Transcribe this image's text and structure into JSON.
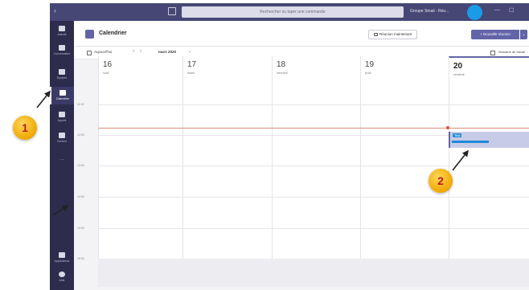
{
  "titlebar": {
    "search_placeholder": "Rechercher ou taper une commande",
    "org_label": "Groupe Smail - Réu..."
  },
  "rail": {
    "items": [
      {
        "icon": "activity-icon",
        "label": "Activité"
      },
      {
        "icon": "chat-icon",
        "label": "Conversation"
      },
      {
        "icon": "teams-icon",
        "label": "Équipes"
      },
      {
        "icon": "calendar-icon",
        "label": "Calendrier",
        "active": true
      },
      {
        "icon": "calls-icon",
        "label": "Appels"
      },
      {
        "icon": "files-icon",
        "label": "Fichiers"
      }
    ],
    "more": "···",
    "bottom": [
      {
        "icon": "apps-icon",
        "label": "Applications"
      },
      {
        "icon": "help-icon",
        "label": "Aide"
      }
    ]
  },
  "header": {
    "title": "Calendrier",
    "meet_now": "Réunion maintenant",
    "new_meeting": "+ Nouvelle réunion"
  },
  "toolbar": {
    "today": "Aujourd'hui",
    "month": "mars 2020",
    "view": "Semaine de travail"
  },
  "days": [
    {
      "num": "16",
      "name": "lundi"
    },
    {
      "num": "17",
      "name": "mardi"
    },
    {
      "num": "18",
      "name": "mercredi"
    },
    {
      "num": "19",
      "name": "jeudi"
    },
    {
      "num": "20",
      "name": "vendredi",
      "today": true
    }
  ],
  "times": [
    "11:00",
    "12:00",
    "13:00",
    "14:00",
    "15:00",
    "16:00"
  ],
  "event": {
    "title": "Test"
  },
  "callouts": {
    "one": "1",
    "two": "2"
  },
  "colors": {
    "brand": "#6264a7",
    "rail": "#2d2c4d",
    "titlebar": "#464775",
    "callout": "#f0a800"
  }
}
